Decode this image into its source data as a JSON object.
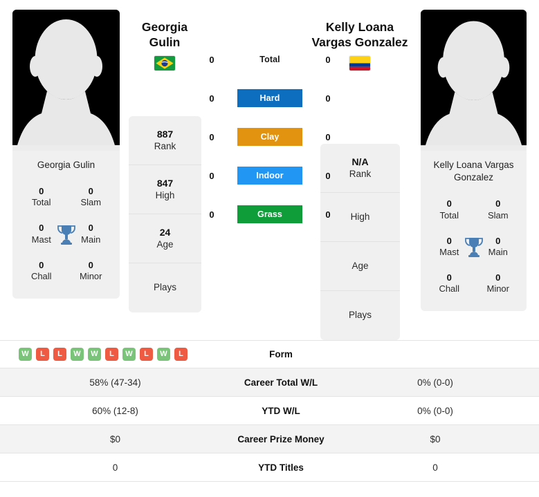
{
  "players": {
    "left": {
      "first_name": "Georgia",
      "last_name": "Gulin",
      "full_name": "Georgia Gulin",
      "country_flag": "brazil-flag",
      "rank": "887",
      "high": "847",
      "age": "24",
      "plays": "",
      "titles": {
        "total": "0",
        "slam": "0",
        "mast": "0",
        "main": "0",
        "chall": "0",
        "minor": "0"
      }
    },
    "right": {
      "first_name": "Kelly Loana",
      "last_name": "Vargas Gonzalez",
      "full_name": "Kelly Loana Vargas Gonzalez",
      "country_flag": "colombia-flag",
      "rank": "N/A",
      "high": "",
      "age": "",
      "plays": "",
      "titles": {
        "total": "0",
        "slam": "0",
        "mast": "0",
        "main": "0",
        "chall": "0",
        "minor": "0"
      }
    }
  },
  "rank_labels": {
    "rank": "Rank",
    "high": "High",
    "age": "Age",
    "plays": "Plays"
  },
  "title_labels": {
    "total": "Total",
    "slam": "Slam",
    "mast": "Mast",
    "main": "Main",
    "chall": "Chall",
    "minor": "Minor"
  },
  "surfaces": [
    {
      "label": "Total",
      "left_value": "0",
      "right_value": "0",
      "color": "transparent",
      "text_color": "#1a1a1a"
    },
    {
      "label": "Hard",
      "left_value": "0",
      "right_value": "0",
      "color": "#0d6ec0",
      "text_color": "#ffffff"
    },
    {
      "label": "Clay",
      "left_value": "0",
      "right_value": "0",
      "color": "#e2930f",
      "text_color": "#ffffff"
    },
    {
      "label": "Indoor",
      "left_value": "0",
      "right_value": "0",
      "color": "#2196f3",
      "text_color": "#ffffff"
    },
    {
      "label": "Grass",
      "left_value": "0",
      "right_value": "0",
      "color": "#0f9d3a",
      "text_color": "#ffffff"
    }
  ],
  "form": {
    "label": "Form",
    "results": [
      "W",
      "L",
      "L",
      "W",
      "W",
      "L",
      "W",
      "L",
      "W",
      "L"
    ],
    "win_color": "#7ac47a",
    "loss_color": "#ee5a42"
  },
  "stats_rows": [
    {
      "label": "Career Total W/L",
      "left": "58% (47-34)",
      "right": "0% (0-0)"
    },
    {
      "label": "YTD W/L",
      "left": "60% (12-8)",
      "right": "0% (0-0)"
    },
    {
      "label": "Career Prize Money",
      "left": "$0",
      "right": "$0"
    },
    {
      "label": "YTD Titles",
      "left": "0",
      "right": "0"
    }
  ]
}
